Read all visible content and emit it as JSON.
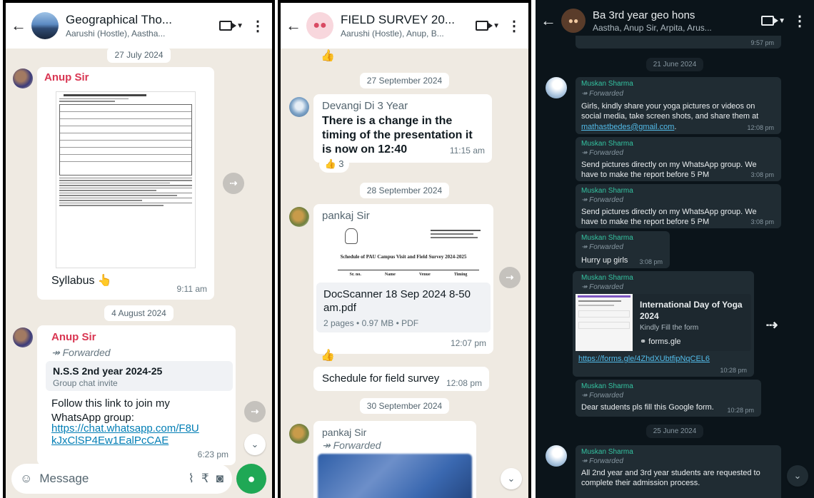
{
  "p1": {
    "title": "Geographical Tho...",
    "subtitle": "Aarushi (Hostle), Aastha...",
    "date1": "27 July 2024",
    "msg1": {
      "sender": "Anup Sir",
      "caption": "Syllabus 👆",
      "time": "9:11 am"
    },
    "date2": "4 August 2024",
    "msg2": {
      "sender": "Anup Sir",
      "forwarded": "Forwarded",
      "card_title": "N.S.S 2nd year 2024-25",
      "card_sub": "Group chat invite",
      "text": "Follow this link to join my WhatsApp group:",
      "link": "https://chat.whatsapp.com/F8UkJxClSP4Ew1EalPcCAE",
      "time": "6:23 pm"
    },
    "input_placeholder": "Message"
  },
  "p2": {
    "title": "FIELD SURVEY 20...",
    "subtitle": "Aarushi (Hostle), Anup, B...",
    "date1": "27 September 2024",
    "msg1": {
      "sender": "Devangi Di 3 Year",
      "text": "There is a change in the timing of the presentation it is now on 12:40",
      "time": "11:15 am",
      "reaction": "👍 3"
    },
    "date2": "28 September 2024",
    "msg2": {
      "sender": "pankaj Sir",
      "doc_heading": "Schedule of PAU Campus Visit and Field Survey 2024-2025",
      "doc_col1": "Sr. no.",
      "doc_col2": "Name",
      "doc_col3": "Venue",
      "doc_col4": "Timing",
      "file": "DocScanner 18 Sep 2024 8-50 am.pdf",
      "meta": "2 pages • 0.97 MB • PDF",
      "time": "12:07 pm"
    },
    "msg3": {
      "text": "Schedule for field survey",
      "time": "12:08 pm"
    },
    "date3": "30 September 2024",
    "msg4": {
      "sender": "pankaj Sir",
      "forwarded": "Forwarded"
    }
  },
  "p3": {
    "title": "Ba 3rd year geo hons",
    "subtitle": "Aastha, Anup Sir, Arpita, Arus...",
    "top_time": "9:57 pm",
    "date1": "21 June 2024",
    "m1": {
      "sender": "Muskan Sharma",
      "forwarded": "Forwarded",
      "text": "Girls, kindly share your yoga pictures or videos on social media, take screen shots, and share them at",
      "email": "mathastbedes@gmail.com",
      "dot": ".",
      "time": "12:08 pm"
    },
    "m2": {
      "sender": "Muskan Sharma",
      "forwarded": "Forwarded",
      "text": "Send pictures directly on my WhatsApp group. We have to make the report before 5 PM",
      "time": "3:08 pm"
    },
    "m3": {
      "sender": "Muskan Sharma",
      "forwarded": "Forwarded",
      "text": "Send pictures directly on my WhatsApp group. We have to make the report before 5 PM",
      "time": "3:08 pm"
    },
    "m4": {
      "sender": "Muskan Sharma",
      "forwarded": "Forwarded",
      "text": "Hurry up girls",
      "time": "3:08 pm"
    },
    "m5": {
      "sender": "Muskan Sharma",
      "forwarded": "Forwarded",
      "card_title": "International Day of Yoga 2024",
      "card_sub": "Kindly Fill the form",
      "card_domain": "forms.gle",
      "link": "https://forms.gle/4ZhdXUbtfipNqCEL6",
      "time": "10:28 pm"
    },
    "m6": {
      "sender": "Muskan Sharma",
      "forwarded": "Forwarded",
      "text": "Dear students pls fill this Google form.",
      "time": "10:28 pm"
    },
    "date2": "25 June 2024",
    "m7": {
      "sender": "Muskan Sharma",
      "forwarded": "Forwarded",
      "text": "All 2nd year and 3rd year students are requested to complete their admission process."
    }
  }
}
